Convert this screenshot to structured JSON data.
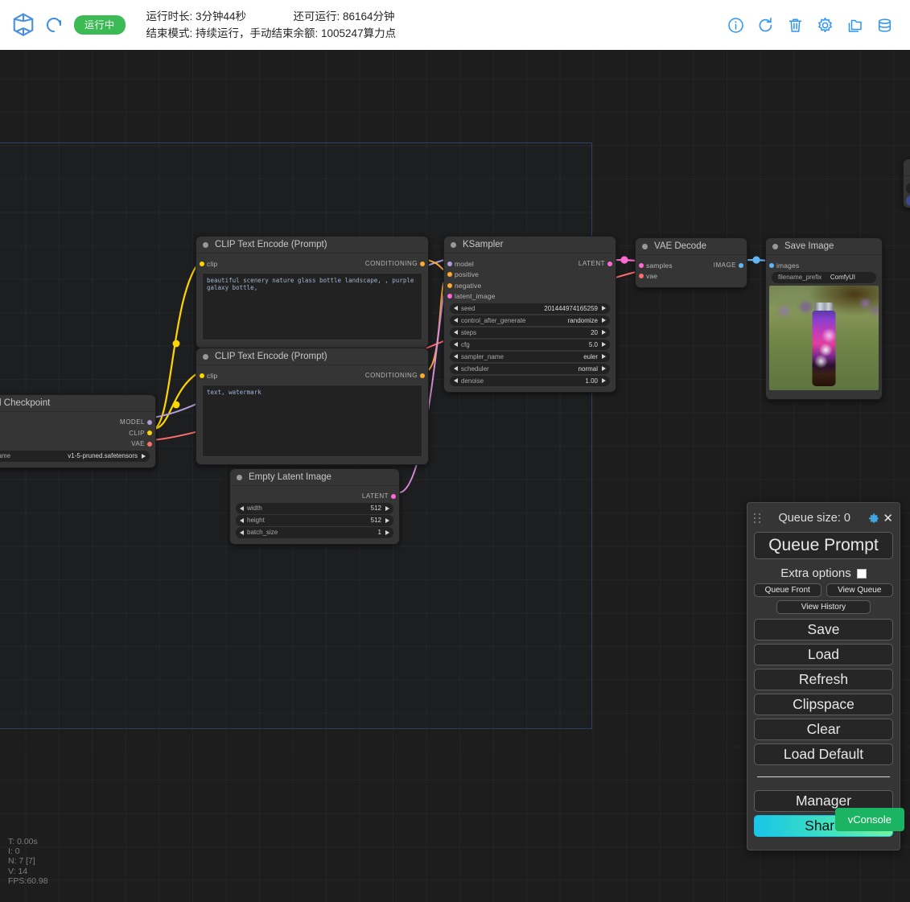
{
  "header": {
    "logo_icon": "cube-logo-icon",
    "spinner_icon": "loading-spinner-icon",
    "status_badge": "运行中",
    "runtime_label": "运行时长: 3分钟44秒",
    "end_mode_label": "结束模式: 持续运行，手动结束",
    "remaining_label": "还可运行: 86164分钟",
    "balance_label": "余额: 1005247算力点",
    "icons": [
      {
        "name": "info-icon"
      },
      {
        "name": "refresh-icon"
      },
      {
        "name": "trash-icon"
      },
      {
        "name": "gear-icon"
      },
      {
        "name": "folder-icon"
      },
      {
        "name": "database-icon"
      }
    ]
  },
  "nodes": {
    "load_checkpoint": {
      "title": "Load Checkpoint",
      "outputs": [
        {
          "label": "MODEL",
          "color": "#b39ddb"
        },
        {
          "label": "CLIP",
          "color": "#ffd500"
        },
        {
          "label": "VAE",
          "color": "#ff6e6e"
        }
      ],
      "widgets": [
        {
          "name": "ckpt_name",
          "value": "v1-5-pruned.safetensors"
        }
      ]
    },
    "clip_positive": {
      "title": "CLIP Text Encode (Prompt)",
      "input": {
        "label": "clip",
        "color": "#ffd500"
      },
      "output": {
        "label": "CONDITIONING",
        "color": "#ffa931"
      },
      "text": "beautiful scenery nature glass bottle landscape, , purple galaxy bottle,"
    },
    "clip_negative": {
      "title": "CLIP Text Encode (Prompt)",
      "input": {
        "label": "clip",
        "color": "#ffd500"
      },
      "output": {
        "label": "CONDITIONING",
        "color": "#ffa931"
      },
      "text": "text, watermark"
    },
    "ksampler": {
      "title": "KSampler",
      "inputs": [
        {
          "label": "model",
          "color": "#b39ddb"
        },
        {
          "label": "positive",
          "color": "#ffa931"
        },
        {
          "label": "negative",
          "color": "#ffa931"
        },
        {
          "label": "latent_image",
          "color": "#ff6ad5"
        }
      ],
      "output": {
        "label": "LATENT",
        "color": "#ff6ad5"
      },
      "widgets": [
        {
          "name": "seed",
          "value": "201444974165259"
        },
        {
          "name": "control_after_generate",
          "value": "randomize"
        },
        {
          "name": "steps",
          "value": "20"
        },
        {
          "name": "cfg",
          "value": "5.0"
        },
        {
          "name": "sampler_name",
          "value": "euler"
        },
        {
          "name": "scheduler",
          "value": "normal"
        },
        {
          "name": "denoise",
          "value": "1.00"
        }
      ]
    },
    "empty_latent": {
      "title": "Empty Latent Image",
      "output": {
        "label": "LATENT",
        "color": "#ff6ad5"
      },
      "widgets": [
        {
          "name": "width",
          "value": "512"
        },
        {
          "name": "height",
          "value": "512"
        },
        {
          "name": "batch_size",
          "value": "1"
        }
      ]
    },
    "vae_decode": {
      "title": "VAE Decode",
      "inputs": [
        {
          "label": "samples",
          "color": "#ff6ad5"
        },
        {
          "label": "vae",
          "color": "#ff6e6e"
        }
      ],
      "output": {
        "label": "IMAGE",
        "color": "#64b5f6"
      }
    },
    "save_image": {
      "title": "Save Image",
      "input": {
        "label": "images",
        "color": "#64b5f6"
      },
      "widgets": [
        {
          "name": "filename_prefix",
          "value": "ComfyUI"
        }
      ],
      "preview_alt": "purple galaxy glass bottle on green grass"
    }
  },
  "menu": {
    "queue_size_label": "Queue size: 0",
    "gear_icon": "gear-icon",
    "close_icon": "close-icon",
    "queue_prompt_label": "Queue Prompt",
    "extra_options_label": "Extra options",
    "queue_front_label": "Queue Front",
    "view_queue_label": "View Queue",
    "view_history_label": "View History",
    "save_label": "Save",
    "load_label": "Load",
    "refresh_label": "Refresh",
    "clipspace_label": "Clipspace",
    "clear_label": "Clear",
    "load_default_label": "Load Default",
    "manager_label": "Manager",
    "share_label": "Share"
  },
  "stats": {
    "time": "T: 0.00s",
    "iterations": "I: 0",
    "nodes": "N: 7 [7]",
    "vertices": "V: 14",
    "fps": "FPS:60.98"
  },
  "vconsole": {
    "label": "vConsole"
  },
  "colors": {
    "accent_blue": "#2a95f5",
    "status_green": "#3cba54",
    "vconsole_green": "#1bb462",
    "link_clip": "#ffd500",
    "link_model": "#b39ddb",
    "link_vae": "#ff6e6e",
    "link_cond": "#ffa931",
    "link_latent": "#ff6ad5",
    "link_image": "#64b5f6"
  }
}
